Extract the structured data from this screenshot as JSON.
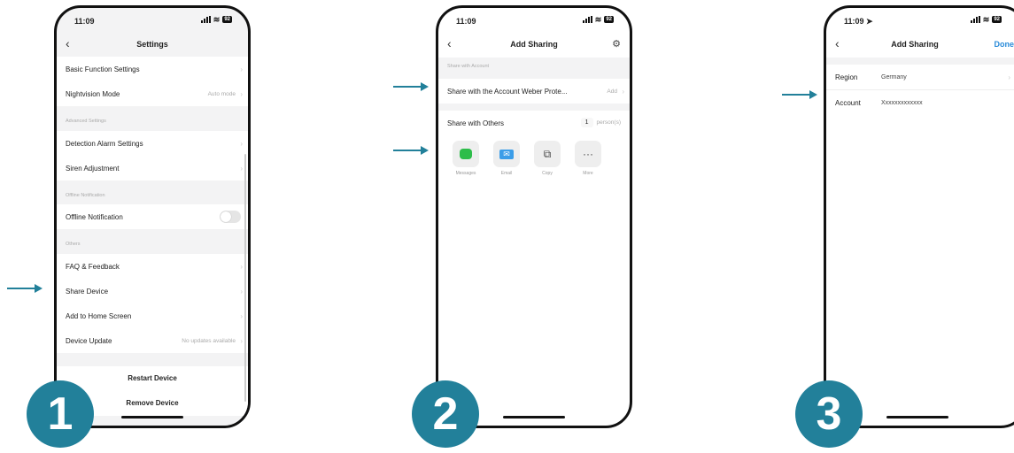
{
  "status": {
    "time": "11:09",
    "battery": "92"
  },
  "steps": [
    "1",
    "2",
    "3"
  ],
  "accent": "#22809a",
  "screen1": {
    "title": "Settings",
    "basic": "Basic Function Settings",
    "nightvision": "Nightvision Mode",
    "nightvision_value": "Auto mode",
    "advanced_header": "Advanced Settings",
    "detection": "Detection Alarm Settings",
    "siren": "Siren Adjustment",
    "offline_header": "Offline Notification",
    "offline": "Offline Notification",
    "others_header": "Others",
    "faq": "FAQ & Feedback",
    "share": "Share Device",
    "home": "Add to Home Screen",
    "update": "Device Update",
    "update_value": "No updates available",
    "restart": "Restart Device",
    "remove": "Remove Device"
  },
  "screen2": {
    "title": "Add Sharing",
    "account_header": "Share with Account",
    "account_row": "Share with the Account Weber Prote...",
    "account_action": "Add",
    "others_label": "Share with Others",
    "others_count": "1",
    "others_unit": "person(s)",
    "tiles": [
      {
        "label": "Messages",
        "icon": "messages-icon"
      },
      {
        "label": "Email",
        "icon": "email-icon"
      },
      {
        "label": "Copy",
        "icon": "copy-icon"
      },
      {
        "label": "More",
        "icon": "more-icon"
      }
    ]
  },
  "screen3": {
    "title": "Add Sharing",
    "done": "Done",
    "region_label": "Region",
    "region_value": "Germany",
    "account_label": "Account",
    "account_value": "Xxxxxxxxxxxxx"
  }
}
